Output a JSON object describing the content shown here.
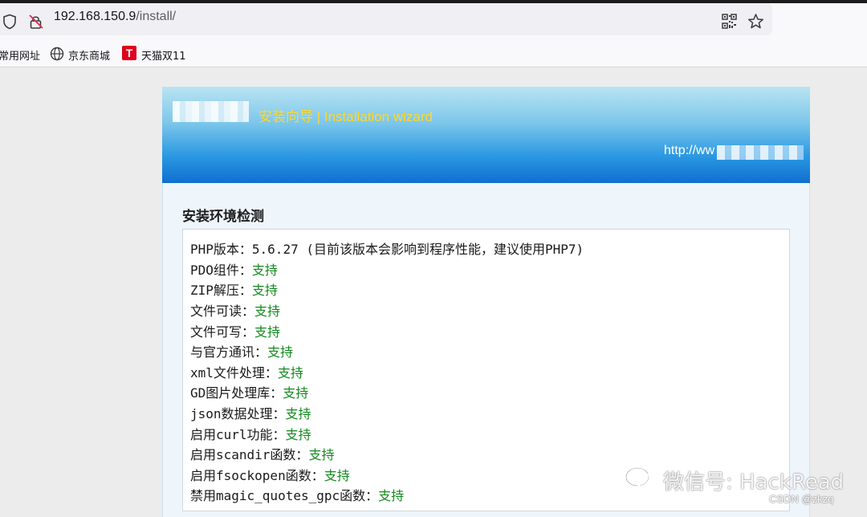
{
  "browser": {
    "url_host": "192.168.150.9",
    "url_path": "/install/",
    "icons": [
      "shield-icon",
      "insecure-lock-icon",
      "qr-code-icon",
      "bookmark-star-icon"
    ],
    "bookmarks": [
      {
        "label": "常用网址",
        "icon": "none"
      },
      {
        "label": "京东商城",
        "icon": "globe-icon"
      },
      {
        "label": "天猫双11",
        "icon": "tmall-icon",
        "icon_glyph": "T"
      }
    ]
  },
  "installer": {
    "wizard_title": "安装向导 | Installation wizard",
    "site_url_prefix": "http://ww",
    "section_title": "安装环境检测",
    "checks": [
      {
        "label": "PHP版本：",
        "value": "5.6.27 (目前该版本会影响到程序性能，建议使用PHP7)",
        "status": ""
      },
      {
        "label": "PDO组件：",
        "value": "",
        "status": "支持"
      },
      {
        "label": "ZIP解压：",
        "value": "",
        "status": "支持"
      },
      {
        "label": "文件可读：",
        "value": "",
        "status": "支持"
      },
      {
        "label": "文件可写：",
        "value": "",
        "status": "支持"
      },
      {
        "label": "与官方通讯：",
        "value": "",
        "status": "支持"
      },
      {
        "label": "xml文件处理：",
        "value": "",
        "status": "支持"
      },
      {
        "label": "GD图片处理库：",
        "value": "",
        "status": "支持"
      },
      {
        "label": "json数据处理：",
        "value": "",
        "status": "支持"
      },
      {
        "label": "启用curl功能：",
        "value": "",
        "status": "支持"
      },
      {
        "label": "启用scandir函数：",
        "value": "",
        "status": "支持"
      },
      {
        "label": "启用fsockopen函数：",
        "value": "",
        "status": "支持"
      },
      {
        "label": "禁用magic_quotes_gpc函数：",
        "value": "",
        "status": "支持"
      }
    ]
  },
  "watermark": {
    "wechat": "微信号: HackRead",
    "csdn": "CSDN @zkzq"
  },
  "colors": {
    "status_green": "#138a1e",
    "title_yellow": "#ffd72a",
    "banner_blue": "#1479d6"
  }
}
